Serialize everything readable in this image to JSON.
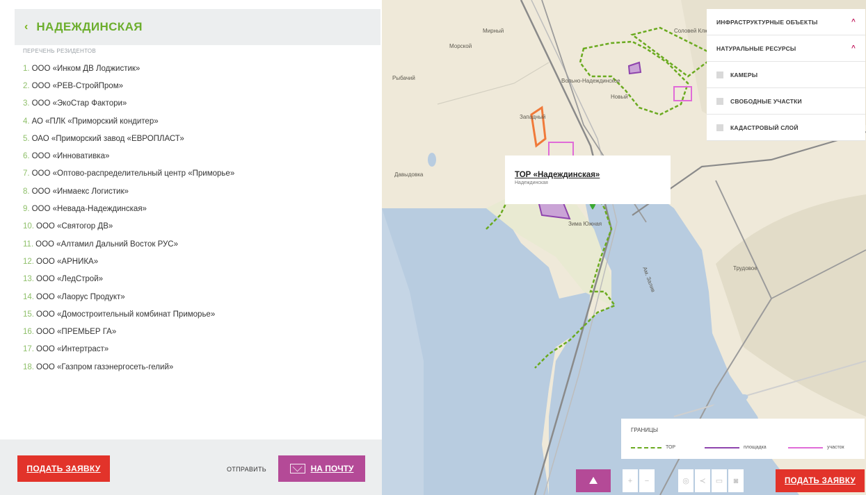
{
  "header": {
    "back_icon": "‹",
    "title": "НАДЕЖДИНСКАЯ"
  },
  "list_caption": "ПЕРЕЧЕНЬ РЕЗИДЕНТОВ",
  "residents": [
    {
      "num": "1.",
      "name": "ООО «Инком ДВ Лоджистик»"
    },
    {
      "num": "2.",
      "name": "ООО «РЕВ-СтройПром»"
    },
    {
      "num": "3.",
      "name": "ООО «ЭкоСтар Фактори»"
    },
    {
      "num": "4.",
      "name": "АО «ПЛК «Приморский кондитер»"
    },
    {
      "num": "5.",
      "name": "ОАО «Приморский завод «ЕВРОПЛАСТ»"
    },
    {
      "num": "6.",
      "name": "ООО «Инновативка»"
    },
    {
      "num": "7.",
      "name": "ООО «Оптово-распределительный центр «Приморье»"
    },
    {
      "num": "8.",
      "name": "ООО «Инмаекс Логистик»"
    },
    {
      "num": "9.",
      "name": "ООО «Невада-Надеждинская»"
    },
    {
      "num": "10.",
      "name": "ООО «Святогор ДВ»"
    },
    {
      "num": "11.",
      "name": "ООО «Алтамил Дальний Восток РУС»"
    },
    {
      "num": "12.",
      "name": "ООО «АРНИКА»"
    },
    {
      "num": "13.",
      "name": "ООО «ЛедСтрой»"
    },
    {
      "num": "14.",
      "name": "ООО «Лаорус Продукт»"
    },
    {
      "num": "15.",
      "name": "ООО «Домостроительный комбинат Приморье»"
    },
    {
      "num": "16.",
      "name": "ООО «ПРЕМЬЕР ГА»"
    },
    {
      "num": "17.",
      "name": "ООО «Интертраст»"
    },
    {
      "num": "18.",
      "name": "ООО «Газпром газэнергосеть-гелий»"
    }
  ],
  "footer": {
    "apply_label": "ПОДАТЬ ЗАЯВКУ",
    "send_label": "ОТПРАВИТЬ",
    "mail_label": "НА ПОЧТУ"
  },
  "layers": {
    "infrastructure": "ИНФРАСТРУКТУРНЫЕ ОБЪЕКТЫ",
    "natural": "НАТУРАЛЬНЫЕ РЕСУРСЫ",
    "cameras": "КАМЕРЫ",
    "free_plots": "СВОБОДНЫЕ УЧАСТКИ",
    "cadastral": "КАДАСТРОВЫЙ СЛОЙ",
    "chevron": "^"
  },
  "popup": {
    "title": "ТОР «Надеждинская»",
    "subtitle": "Надеждинская"
  },
  "map_places": {
    "morskoy": "Морской",
    "ryboviy": "Рыбачий",
    "mirniy": "Мирный",
    "nadezhdinsky": "Вольно-Надеждинское",
    "novy": "Новый",
    "zapadniy": "Западный",
    "davydovka": "Давыдовка",
    "yuzhniy": "Зима Южная",
    "trudovoe": "Трудовое",
    "sosnovy": "Соловей Ключ",
    "bay": "Ам. Залив"
  },
  "legend": {
    "title": "ГРАНИЦЫ",
    "tor": "ТОР",
    "site": "площадка",
    "plot": "участок"
  },
  "map_tools": {
    "apply_label": "ПОДАТЬ ЗАЯВКУ"
  },
  "colors": {
    "accent_green": "#6cae2d",
    "apply_red": "#e2332a",
    "mail_purple": "#b44a97",
    "border_green": "#6aaa1f",
    "site_purple": "#8e44ad",
    "plot_pink": "#e06bd8"
  }
}
